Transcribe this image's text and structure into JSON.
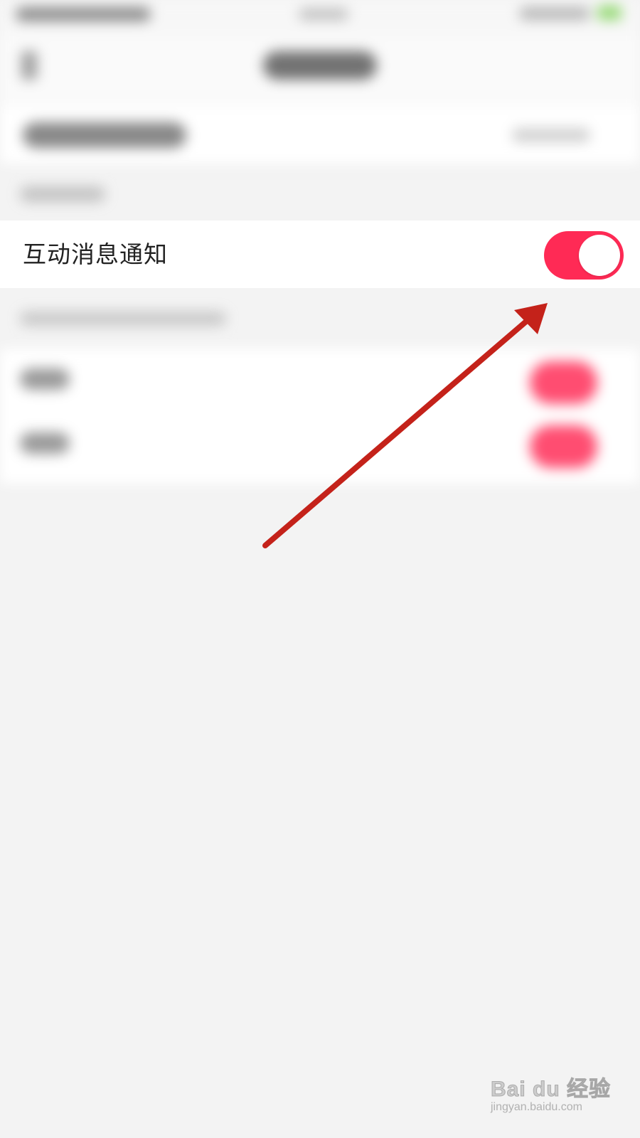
{
  "setting": {
    "label": "互动消息通知",
    "toggle_on": true,
    "toggle_color": "#ff2a55"
  },
  "annotation": {
    "color": "#c4221a",
    "icon": "arrow-icon"
  },
  "watermark": {
    "text": "Bai du 经验",
    "subtext": "jingyan.baidu.com"
  },
  "colors": {
    "background": "#f3f3f3",
    "row_background": "#ffffff",
    "text": "#222222"
  }
}
